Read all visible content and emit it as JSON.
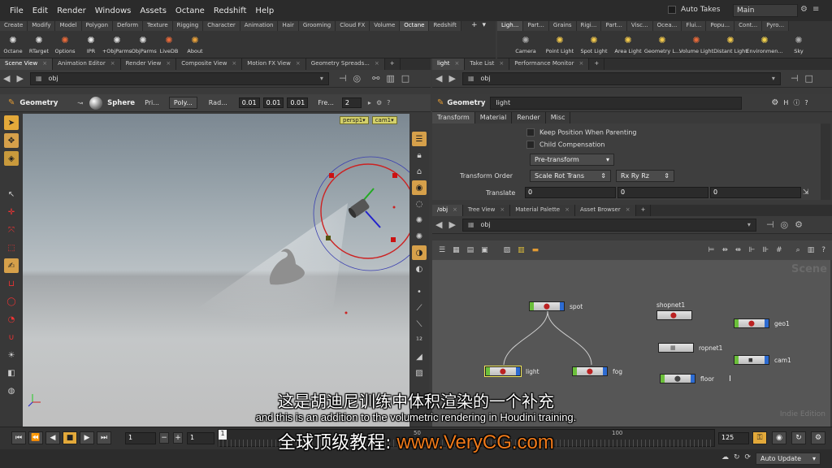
{
  "menubar": {
    "items": [
      "File",
      "Edit",
      "Render",
      "Windows",
      "Assets",
      "Octane",
      "Redshift",
      "Help"
    ],
    "auto_takes": "Auto Takes",
    "desktop": "Main"
  },
  "shelf_left": {
    "tabs": [
      "Create",
      "Modify",
      "Model",
      "Polygon",
      "Deform",
      "Texture",
      "Rigging",
      "Character",
      "Animation",
      "Hair",
      "Grooming",
      "Cloud FX",
      "Volume",
      "Octane",
      "Redshift"
    ],
    "active_tab": "Octane",
    "tools": [
      "Octane",
      "RTarget",
      "Options",
      "IPR",
      "+ObjParms",
      "-ObjParms",
      "LiveDB",
      "About"
    ]
  },
  "shelf_right": {
    "tabs": [
      "Ligh...",
      "Part...",
      "Grains",
      "Rigi...",
      "Part...",
      "Visc...",
      "Ocea...",
      "Flui...",
      "Popu...",
      "Cont...",
      "Pyro..."
    ],
    "active_tab": "Ligh...",
    "tools": [
      "Camera",
      "Point Light",
      "Spot Light",
      "Area Light",
      "Geometry L...",
      "Volume Light",
      "Distant Light",
      "Environmen...",
      "Sky"
    ]
  },
  "left_pane": {
    "tabs": [
      "Scene View",
      "Animation Editor",
      "Render View",
      "Composite View",
      "Motion FX View",
      "Geometry Spreads..."
    ],
    "path": "obj",
    "toolbar": {
      "geometry": "Geometry",
      "sphere": "Sphere",
      "pri": "Pri...",
      "poly": "Poly...",
      "rad": "Rad...",
      "rad_x": "0.01",
      "rad_y": "0.01",
      "rad_z": "0.01",
      "freq_label": "Fre...",
      "freq": "2"
    },
    "viewport": {
      "camera_menu": "persp1",
      "cam_menu": "cam1"
    }
  },
  "params_pane": {
    "tabs": [
      "light",
      "Take List",
      "Performance Monitor"
    ],
    "path": "obj",
    "type": "Geometry",
    "node_name": "light",
    "param_tabs": [
      "Transform",
      "Material",
      "Render",
      "Misc"
    ],
    "active_param_tab": "Transform",
    "keep_position": "Keep Position When Parenting",
    "child_comp": "Child Compensation",
    "pre_transform": "Pre-transform",
    "transform_order_label": "Transform Order",
    "transform_order": "Scale Rot Trans",
    "rotate_order": "Rx Ry Rz",
    "translate_label": "Translate",
    "translate": [
      "0",
      "0",
      "0"
    ]
  },
  "network_pane": {
    "tabs": [
      "/obj",
      "Tree View",
      "Material Palette",
      "Asset Browser"
    ],
    "path": "obj",
    "nodes": {
      "spot": "spot",
      "light": "light",
      "fog": "fog",
      "shopnet1": "shopnet1",
      "ropnet1": "ropnet1",
      "floor": "floor",
      "geo1": "geo1",
      "cam1": "cam1"
    },
    "watermark": "Scene",
    "edition": "Indie Edition"
  },
  "timeline": {
    "frame": "1",
    "start": "1",
    "ticks": [
      "1",
      "50",
      "100"
    ],
    "end": "125"
  },
  "status": {
    "auto_update": "Auto Update"
  },
  "subtitles": {
    "chinese": "这是胡迪尼训练中体积渲染的一个补充",
    "english": "and this is an addition to the volumetric rendering in Houdini training.",
    "site_prefix": "全球顶级教程:",
    "site": "www.VeryCG.com"
  }
}
